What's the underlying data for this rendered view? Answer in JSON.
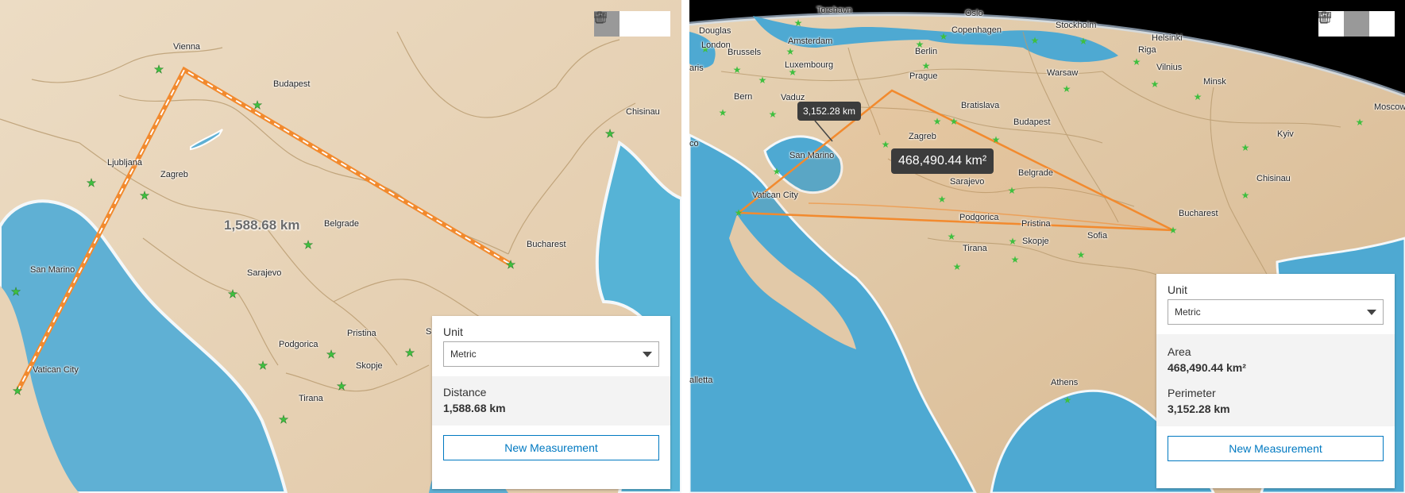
{
  "colors": {
    "accent": "#0079c1",
    "measure_line": "#f28a2e"
  },
  "left_view": {
    "toolbar": [
      {
        "name": "distance-measurement-button",
        "icon": "ruler-icon",
        "active": true
      },
      {
        "name": "area-measurement-button",
        "icon": "area-icon",
        "active": false
      },
      {
        "name": "clear-measurements-button",
        "icon": "trash-icon",
        "active": false
      }
    ],
    "map_label": "1,588.68 km",
    "cities": [
      "Vienna",
      "Budapest",
      "Chisinau",
      "Ljubljana",
      "Zagreb",
      "Belgrade",
      "Bucharest",
      "San Marino",
      "Sarajevo",
      "Pristina",
      "Podgorica",
      "Skopje",
      "Vatican City",
      "Tirana",
      "S"
    ],
    "panel": {
      "unit_label": "Unit",
      "unit_value": "Metric",
      "result_label": "Distance",
      "result_value": "1,588.68 km",
      "new_button": "New Measurement"
    }
  },
  "right_view": {
    "toolbar": [
      {
        "name": "distance-measurement-button",
        "icon": "ruler-icon",
        "active": false
      },
      {
        "name": "area-measurement-button",
        "icon": "area-icon",
        "active": true
      },
      {
        "name": "clear-measurements-button",
        "icon": "trash-icon",
        "active": false
      }
    ],
    "perimeter_tip": "3,152.28 km",
    "area_tip": "468,490.44 km²",
    "cities": [
      "Torshavn",
      "Oslo",
      "Douglas",
      "Copenhagen",
      "Stockholm",
      "Helsinki",
      "London",
      "Amsterdam",
      "Riga",
      "aris",
      "Brussels",
      "Berlin",
      "Vilnius",
      "Luxembourg",
      "Prague",
      "Warsaw",
      "Minsk",
      "Bern",
      "Vaduz",
      "Bratislava",
      "Moscow",
      "Budapest",
      "Kyiv",
      "co",
      "Zagreb",
      "San Marino",
      "Chisinau",
      "Belgrade",
      "Vatican City",
      "Sarajevo",
      "Bucharest",
      "Podgorica",
      "Pristina",
      "Sofia",
      "Skopje",
      "Tirana",
      "alletta",
      "Athens"
    ],
    "panel": {
      "unit_label": "Unit",
      "unit_value": "Metric",
      "area_label": "Area",
      "area_value": "468,490.44 km²",
      "perimeter_label": "Perimeter",
      "perimeter_value": "3,152.28 km",
      "new_button": "New Measurement"
    }
  }
}
